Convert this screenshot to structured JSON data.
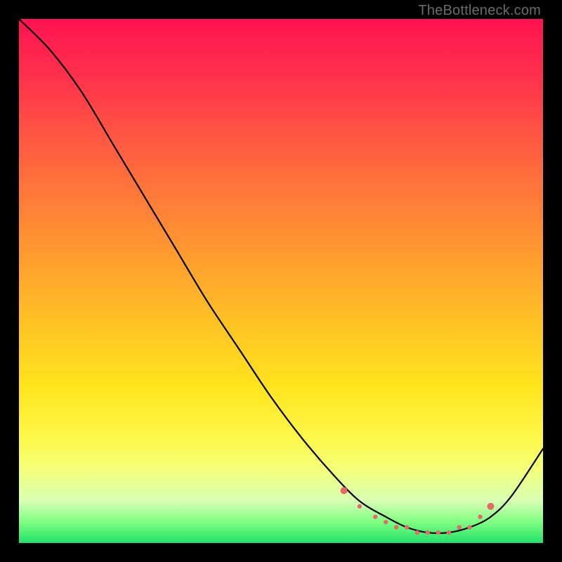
{
  "watermark": "TheBottleneck.com",
  "chart_data": {
    "type": "line",
    "title": "",
    "xlabel": "",
    "ylabel": "",
    "xlim": [
      0,
      100
    ],
    "ylim": [
      0,
      100
    ],
    "grid": false,
    "legend": false,
    "series": [
      {
        "name": "bottleneck-curve",
        "x": [
          0,
          6,
          12,
          18,
          24,
          30,
          36,
          42,
          48,
          54,
          60,
          65,
          70,
          74,
          78,
          82,
          86,
          90,
          94,
          100
        ],
        "y": [
          100,
          94,
          86,
          76,
          66,
          56,
          46,
          37,
          28,
          20,
          13,
          8,
          5,
          3,
          2,
          2,
          3,
          5,
          9,
          18
        ]
      }
    ],
    "markers": {
      "name": "highlight-points",
      "color": "#e46a6a",
      "x": [
        62,
        65,
        68,
        70,
        72,
        74,
        76,
        78,
        80,
        82,
        84,
        86,
        88,
        90
      ],
      "y": [
        10,
        7,
        5,
        4,
        3,
        3,
        2,
        2,
        2,
        2,
        3,
        3,
        5,
        7
      ]
    }
  }
}
